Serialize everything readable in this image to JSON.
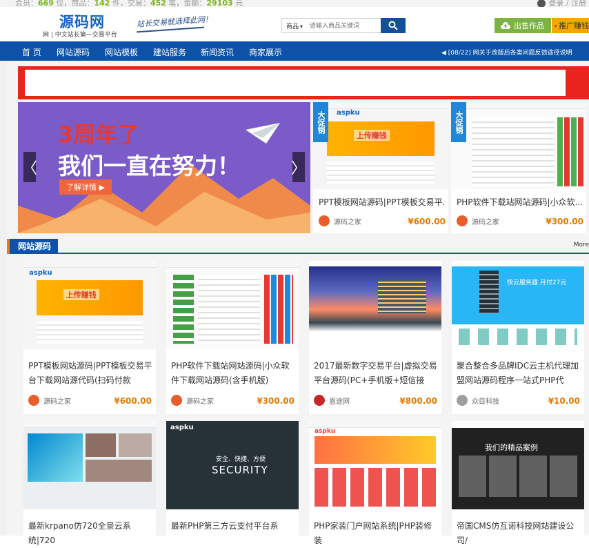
{
  "topbar": {
    "members_label": "会员：",
    "members_value": "669",
    "members_unit": "位，商品：",
    "goods_value": "142",
    "goods_unit": "件，交易：",
    "trades_value": "452",
    "trades_unit": "笔，金额：",
    "amount_value": "29103",
    "amount_unit": "元",
    "login": "登录 / 注册"
  },
  "header": {
    "logo_text": "源码网",
    "logo_sub": "网 | 中文站长第一交易平台",
    "slogan": "站长交易就选择此网！",
    "search_category": "商品",
    "search_placeholder": "请输入商品关键词",
    "sell_label": "出售作品",
    "promo_label": "推广赚钱"
  },
  "nav": {
    "items": [
      "首 页",
      "网站源码",
      "网站模板",
      "建站服务",
      "新闻资讯",
      "商家展示"
    ],
    "notice": "[08/22]        网关于改版后各类问题反馈途径说明"
  },
  "slider": {
    "headline1": "3周年了",
    "headline2": "我们一直在努力！",
    "cta": "了解详情 ▶",
    "prev": "〈",
    "next": "〉"
  },
  "featured": [
    {
      "badge": "大促销",
      "title": "PPT模板网站源码|PPT模板交易平...",
      "seller": "源码之家",
      "price": "¥600.00"
    },
    {
      "badge": "大促销",
      "title": "PHP软件下载站网站源码|小众软...",
      "seller": "源码之家",
      "price": "¥300.00"
    }
  ],
  "section": {
    "title": "网站源码",
    "more": "More"
  },
  "cards": [
    {
      "title": "PPT模板网站源码|PPT模板交易平台下载网站源代码(扫码付款",
      "seller": "源码之家",
      "price": "¥600.00",
      "avatar_color": "#e85d2a"
    },
    {
      "title": "PHP软件下载站网站源码|小众软件下载网站源码(含手机版)",
      "seller": "源码之家",
      "price": "¥300.00",
      "avatar_color": "#e85d2a"
    },
    {
      "title": "2017最新数字交易平台|虚拟交易平台源码(PC+手机版+短信接",
      "seller": "恩途网",
      "price": "¥800.00",
      "avatar_color": "#c62828"
    },
    {
      "title": "聚合整合多品牌IDC云主机代理加盟网站源码程序一站式PHP代",
      "seller": "众目科技",
      "price": "¥10.00",
      "avatar_color": "#9e9e9e"
    },
    {
      "title": "最新krpano仿720全景云系统|720",
      "seller": "",
      "price": "",
      "avatar_color": "#e85d2a"
    },
    {
      "title": "最新PHP第三方云支付平台系",
      "seller": "",
      "price": "",
      "avatar_color": "#e85d2a"
    },
    {
      "title": "PHP家装门户网站系统|PHP装修装",
      "seller": "",
      "price": "",
      "avatar_color": "#e85d2a"
    },
    {
      "title": "帝国CMS仿互诺科技网站建设公司/",
      "seller": "",
      "price": "",
      "avatar_color": "#e85d2a"
    }
  ],
  "thumb_text": {
    "aspku": "aspku",
    "upload_earn": "上传赚钱",
    "security": "SECURITY",
    "security_cn": "安全、快捷、方便",
    "idc_promo": "快云服务器 月付27元",
    "case_title": "我们的精品案例"
  },
  "colors": {
    "brand_blue": "#0d52a6",
    "price_orange": "#e67a00",
    "accent_red": "#e9231d",
    "sell_green": "#7cb342",
    "promo_yellow": "#f5a700"
  }
}
